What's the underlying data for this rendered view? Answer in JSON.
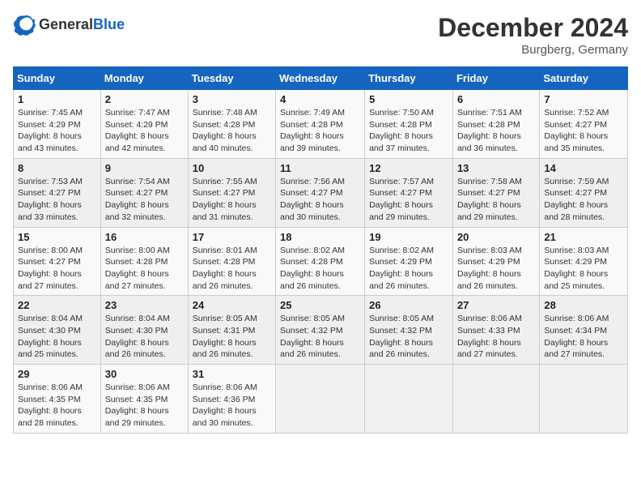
{
  "logo": {
    "text_general": "General",
    "text_blue": "Blue"
  },
  "title": "December 2024",
  "location": "Burgberg, Germany",
  "days_of_week": [
    "Sunday",
    "Monday",
    "Tuesday",
    "Wednesday",
    "Thursday",
    "Friday",
    "Saturday"
  ],
  "weeks": [
    [
      {
        "day": "1",
        "sunrise": "7:45 AM",
        "sunset": "4:29 PM",
        "daylight": "8 hours and 43 minutes."
      },
      {
        "day": "2",
        "sunrise": "7:47 AM",
        "sunset": "4:29 PM",
        "daylight": "8 hours and 42 minutes."
      },
      {
        "day": "3",
        "sunrise": "7:48 AM",
        "sunset": "4:28 PM",
        "daylight": "8 hours and 40 minutes."
      },
      {
        "day": "4",
        "sunrise": "7:49 AM",
        "sunset": "4:28 PM",
        "daylight": "8 hours and 39 minutes."
      },
      {
        "day": "5",
        "sunrise": "7:50 AM",
        "sunset": "4:28 PM",
        "daylight": "8 hours and 37 minutes."
      },
      {
        "day": "6",
        "sunrise": "7:51 AM",
        "sunset": "4:28 PM",
        "daylight": "8 hours and 36 minutes."
      },
      {
        "day": "7",
        "sunrise": "7:52 AM",
        "sunset": "4:27 PM",
        "daylight": "8 hours and 35 minutes."
      }
    ],
    [
      {
        "day": "8",
        "sunrise": "7:53 AM",
        "sunset": "4:27 PM",
        "daylight": "8 hours and 33 minutes."
      },
      {
        "day": "9",
        "sunrise": "7:54 AM",
        "sunset": "4:27 PM",
        "daylight": "8 hours and 32 minutes."
      },
      {
        "day": "10",
        "sunrise": "7:55 AM",
        "sunset": "4:27 PM",
        "daylight": "8 hours and 31 minutes."
      },
      {
        "day": "11",
        "sunrise": "7:56 AM",
        "sunset": "4:27 PM",
        "daylight": "8 hours and 30 minutes."
      },
      {
        "day": "12",
        "sunrise": "7:57 AM",
        "sunset": "4:27 PM",
        "daylight": "8 hours and 29 minutes."
      },
      {
        "day": "13",
        "sunrise": "7:58 AM",
        "sunset": "4:27 PM",
        "daylight": "8 hours and 29 minutes."
      },
      {
        "day": "14",
        "sunrise": "7:59 AM",
        "sunset": "4:27 PM",
        "daylight": "8 hours and 28 minutes."
      }
    ],
    [
      {
        "day": "15",
        "sunrise": "8:00 AM",
        "sunset": "4:27 PM",
        "daylight": "8 hours and 27 minutes."
      },
      {
        "day": "16",
        "sunrise": "8:00 AM",
        "sunset": "4:28 PM",
        "daylight": "8 hours and 27 minutes."
      },
      {
        "day": "17",
        "sunrise": "8:01 AM",
        "sunset": "4:28 PM",
        "daylight": "8 hours and 26 minutes."
      },
      {
        "day": "18",
        "sunrise": "8:02 AM",
        "sunset": "4:28 PM",
        "daylight": "8 hours and 26 minutes."
      },
      {
        "day": "19",
        "sunrise": "8:02 AM",
        "sunset": "4:29 PM",
        "daylight": "8 hours and 26 minutes."
      },
      {
        "day": "20",
        "sunrise": "8:03 AM",
        "sunset": "4:29 PM",
        "daylight": "8 hours and 26 minutes."
      },
      {
        "day": "21",
        "sunrise": "8:03 AM",
        "sunset": "4:29 PM",
        "daylight": "8 hours and 25 minutes."
      }
    ],
    [
      {
        "day": "22",
        "sunrise": "8:04 AM",
        "sunset": "4:30 PM",
        "daylight": "8 hours and 25 minutes."
      },
      {
        "day": "23",
        "sunrise": "8:04 AM",
        "sunset": "4:30 PM",
        "daylight": "8 hours and 26 minutes."
      },
      {
        "day": "24",
        "sunrise": "8:05 AM",
        "sunset": "4:31 PM",
        "daylight": "8 hours and 26 minutes."
      },
      {
        "day": "25",
        "sunrise": "8:05 AM",
        "sunset": "4:32 PM",
        "daylight": "8 hours and 26 minutes."
      },
      {
        "day": "26",
        "sunrise": "8:05 AM",
        "sunset": "4:32 PM",
        "daylight": "8 hours and 26 minutes."
      },
      {
        "day": "27",
        "sunrise": "8:06 AM",
        "sunset": "4:33 PM",
        "daylight": "8 hours and 27 minutes."
      },
      {
        "day": "28",
        "sunrise": "8:06 AM",
        "sunset": "4:34 PM",
        "daylight": "8 hours and 27 minutes."
      }
    ],
    [
      {
        "day": "29",
        "sunrise": "8:06 AM",
        "sunset": "4:35 PM",
        "daylight": "8 hours and 28 minutes."
      },
      {
        "day": "30",
        "sunrise": "8:06 AM",
        "sunset": "4:35 PM",
        "daylight": "8 hours and 29 minutes."
      },
      {
        "day": "31",
        "sunrise": "8:06 AM",
        "sunset": "4:36 PM",
        "daylight": "8 hours and 30 minutes."
      },
      null,
      null,
      null,
      null
    ]
  ]
}
